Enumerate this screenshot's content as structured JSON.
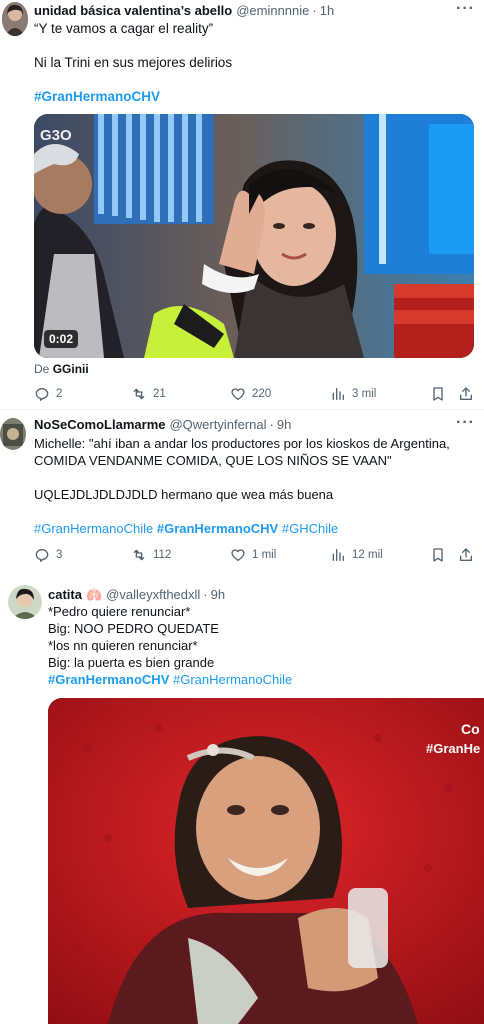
{
  "tweets": [
    {
      "display_name": "unidad básica valentina’s abello",
      "handle": "@eminnnnie",
      "time": "1h",
      "lines": [
        "“Y te vamos a cagar el reality”",
        "",
        "Ni la Trini en sus mejores delirios",
        ""
      ],
      "hashtags_line": "#GranHermanoCHV",
      "video_duration": "0:02",
      "video_watermark": "G3O",
      "from_prefix": "De",
      "from_user": "GGinii",
      "stats": {
        "replies": "2",
        "retweets": "21",
        "likes": "220",
        "views": "3 mil"
      }
    },
    {
      "display_name": "NoSeComoLlamarme",
      "handle": "@Qwertyinfernal",
      "time": "9h",
      "lines": [
        "Michelle: \"ahí iban a andar los productores por los kioskos de Argentina,",
        "COMIDA VENDANME COMIDA, QUE LOS NIÑOS SE VAAN\"",
        "",
        "UQLEJDLJDLDJDLD hermano que wea más buena",
        ""
      ],
      "hashtags": [
        "#GranHermanoChile",
        "#GranHermanoCHV",
        "#GHChile"
      ],
      "stats": {
        "replies": "3",
        "retweets": "112",
        "likes": "1 mil",
        "views": "12 mil"
      }
    },
    {
      "display_name": "catita",
      "name_emoji": "🫁",
      "handle": "@valleyxfthedxll",
      "time": "9h",
      "lines": [
        "*Pedro quiere renunciar*",
        "Big: NOO PEDRO QUEDATE",
        "*los nn quieren renunciar*",
        "Big: la puerta es bien grande"
      ],
      "hashtags": [
        "#GranHermanoCHV",
        "#GranHermanoChile"
      ],
      "image_overlay": [
        "Co",
        "#GranHe"
      ]
    }
  ],
  "colors": {
    "accent": "#1d9bf0",
    "text": "#0f1419",
    "muted": "#536471",
    "divider": "#eff3f4"
  },
  "icons": [
    "more-icon",
    "reply-icon",
    "retweet-icon",
    "like-icon",
    "views-icon",
    "bookmark-icon",
    "share-icon"
  ]
}
